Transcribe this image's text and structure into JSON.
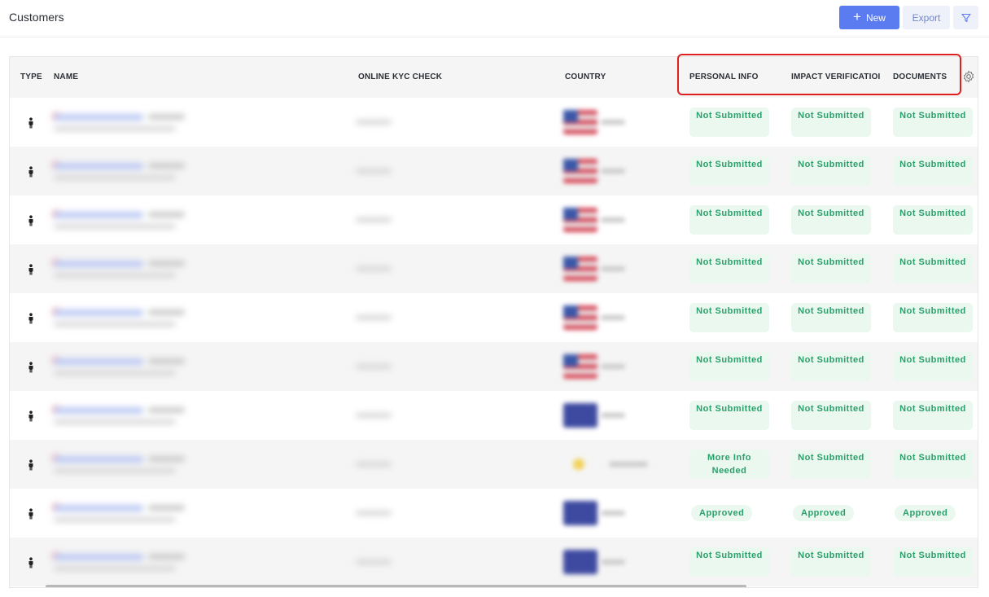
{
  "header": {
    "title": "Customers",
    "new_label": "New",
    "export_label": "Export"
  },
  "table": {
    "columns": {
      "type": "TYPE",
      "name": "NAME",
      "kyc": "ONLINE KYC CHECK",
      "country": "COUNTRY",
      "personal": "PERSONAL INFO",
      "impact": "IMPACT VERIFICATIOI",
      "documents": "DOCUMENTS"
    },
    "rows": [
      {
        "flag": "us",
        "personal": "Not Submitted",
        "impact": "Not Submitted",
        "documents": "Not Submitted"
      },
      {
        "flag": "us",
        "personal": "Not Submitted",
        "impact": "Not Submitted",
        "documents": "Not Submitted"
      },
      {
        "flag": "us",
        "personal": "Not Submitted",
        "impact": "Not Submitted",
        "documents": "Not Submitted"
      },
      {
        "flag": "us",
        "personal": "Not Submitted",
        "impact": "Not Submitted",
        "documents": "Not Submitted"
      },
      {
        "flag": "us",
        "personal": "Not Submitted",
        "impact": "Not Submitted",
        "documents": "Not Submitted"
      },
      {
        "flag": "us",
        "personal": "Not Submitted",
        "impact": "Not Submitted",
        "documents": "Not Submitted"
      },
      {
        "flag": "blue",
        "personal": "Not Submitted",
        "impact": "Not Submitted",
        "documents": "Not Submitted"
      },
      {
        "flag": "star",
        "personal": "More Info Needed",
        "impact": "Not Submitted",
        "documents": "Not Submitted"
      },
      {
        "flag": "blue",
        "personal": "Approved",
        "impact": "Approved",
        "documents": "Approved"
      },
      {
        "flag": "blue",
        "personal": "Not Submitted",
        "impact": "Not Submitted",
        "documents": "Not Submitted"
      }
    ]
  },
  "colors": {
    "accent": "#5a7cf0",
    "status_green": "#2aa16a",
    "status_bg": "#eaf8f0",
    "highlight": "#e02020"
  }
}
